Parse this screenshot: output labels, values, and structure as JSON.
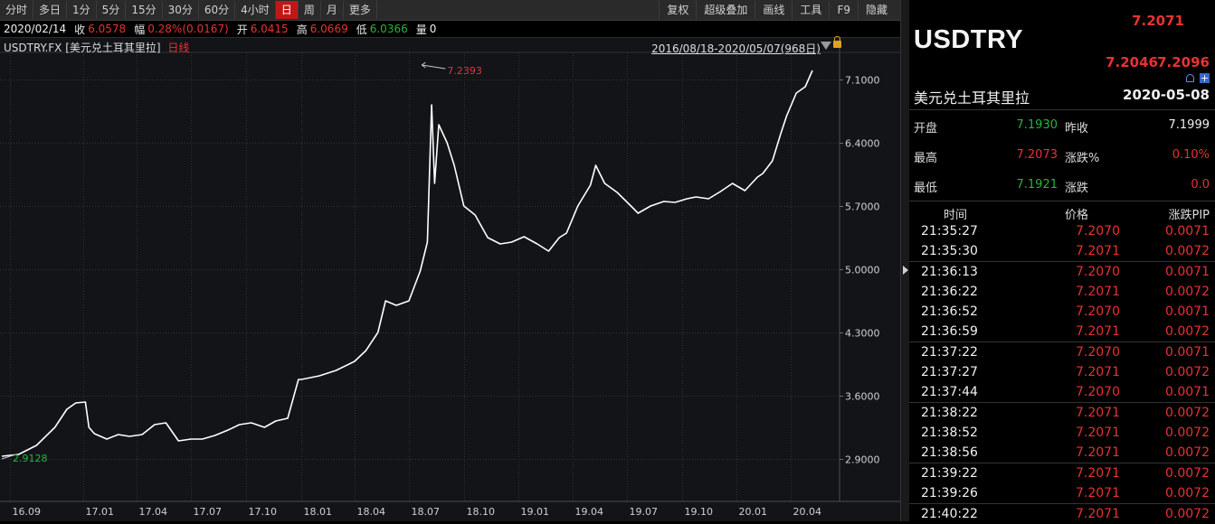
{
  "toolbar": {
    "periods": [
      "分时",
      "多日",
      "1分",
      "5分",
      "15分",
      "30分",
      "60分",
      "4小时",
      "日",
      "周",
      "月",
      "更多"
    ],
    "active_period": "日",
    "right_buttons": [
      "复权",
      "超级叠加",
      "画线",
      "工具",
      "F9",
      "隐藏"
    ]
  },
  "ohlc": {
    "date": "2020/02/14",
    "close_label": "收",
    "close": "6.0578",
    "change_label": "幅",
    "change": "0.28%(0.0167)",
    "open_label": "开",
    "open": "6.0415",
    "high_label": "高",
    "high": "6.0669",
    "low_label": "低",
    "low": "6.0366",
    "volume_label": "量",
    "volume": "0"
  },
  "chart_header": {
    "symbol": "USDTRY.FX",
    "name": "[美元兑土耳其里拉]",
    "period": "日线",
    "range": "2016/08/18-2020/05/07(968日)"
  },
  "chart_data": {
    "type": "line",
    "title": "",
    "x_ticks": [
      "16.09",
      "17.01",
      "17.04",
      "17.07",
      "17.10",
      "18.01",
      "18.04",
      "18.07",
      "18.10",
      "19.01",
      "19.04",
      "19.07",
      "19.10",
      "20.01",
      "20.04"
    ],
    "y_ticks": [
      "7.1000",
      "6.4000",
      "5.7000",
      "5.0000",
      "4.3000",
      "3.6000",
      "2.9000"
    ],
    "ylim": [
      2.6,
      7.3
    ],
    "x": [
      "2016-08-18",
      "2016-09-15",
      "2016-10-15",
      "2016-11-15",
      "2016-12-05",
      "2016-12-20",
      "2017-01-05",
      "2017-01-11",
      "2017-01-20",
      "2017-02-10",
      "2017-03-01",
      "2017-03-20",
      "2017-04-10",
      "2017-05-01",
      "2017-05-20",
      "2017-06-10",
      "2017-07-01",
      "2017-07-20",
      "2017-08-10",
      "2017-09-01",
      "2017-09-20",
      "2017-10-10",
      "2017-11-01",
      "2017-11-20",
      "2017-12-10",
      "2017-12-28",
      "2018-01-02",
      "2018-02-01",
      "2018-03-01",
      "2018-04-01",
      "2018-04-20",
      "2018-05-10",
      "2018-05-23",
      "2018-06-10",
      "2018-07-01",
      "2018-07-20",
      "2018-08-01",
      "2018-08-08",
      "2018-08-13",
      "2018-08-20",
      "2018-08-27",
      "2018-09-03",
      "2018-09-15",
      "2018-10-01",
      "2018-10-20",
      "2018-11-10",
      "2018-12-01",
      "2018-12-20",
      "2019-01-10",
      "2019-02-01",
      "2019-02-20",
      "2019-03-10",
      "2019-03-22",
      "2019-04-10",
      "2019-05-01",
      "2019-05-10",
      "2019-05-25",
      "2019-06-15",
      "2019-07-05",
      "2019-07-20",
      "2019-08-10",
      "2019-09-01",
      "2019-09-20",
      "2019-10-10",
      "2019-10-25",
      "2019-11-15",
      "2019-12-05",
      "2019-12-25",
      "2020-01-15",
      "2020-02-05",
      "2020-02-14",
      "2020-03-01",
      "2020-03-15",
      "2020-03-25",
      "2020-04-10",
      "2020-04-25",
      "2020-05-07"
    ],
    "values": [
      2.93,
      2.95,
      3.05,
      3.25,
      3.45,
      3.52,
      3.53,
      3.25,
      3.18,
      3.12,
      3.17,
      3.15,
      3.17,
      3.28,
      3.3,
      3.1,
      3.12,
      3.12,
      3.16,
      3.22,
      3.28,
      3.3,
      3.25,
      3.32,
      3.35,
      3.78,
      3.78,
      3.82,
      3.88,
      3.98,
      4.1,
      4.3,
      4.65,
      4.6,
      4.65,
      4.98,
      5.3,
      6.82,
      5.95,
      6.6,
      6.5,
      6.4,
      6.15,
      5.7,
      5.6,
      5.35,
      5.28,
      5.3,
      5.36,
      5.28,
      5.2,
      5.35,
      5.4,
      5.7,
      5.93,
      6.15,
      5.95,
      5.85,
      5.72,
      5.62,
      5.7,
      5.75,
      5.74,
      5.78,
      5.8,
      5.78,
      5.86,
      5.95,
      5.87,
      6.02,
      6.06,
      6.2,
      6.5,
      6.7,
      6.95,
      7.02,
      7.2
    ],
    "annotations": [
      {
        "label": "7.2393",
        "x": "2018-08-13",
        "value": 7.2393,
        "color": "#e73232"
      },
      {
        "label": "2.9128",
        "x": "2016-08-18",
        "value": 2.9128,
        "color": "#28b43c"
      }
    ]
  },
  "panel": {
    "symbol": "USDTRY",
    "last_price": "7.2071",
    "bid": "7.2046",
    "ask": "7.2096",
    "name_cn": "美元兑土耳其里拉",
    "date": "2020-05-08",
    "stats": [
      {
        "label1": "开盘",
        "value1": "7.1930",
        "color1": "green",
        "label2": "昨收",
        "value2": "7.1999",
        "color2": "white"
      },
      {
        "label1": "最高",
        "value1": "7.2073",
        "color1": "red",
        "label2": "涨跌%",
        "value2": "0.10%",
        "color2": "red"
      },
      {
        "label1": "最低",
        "value1": "7.1921",
        "color1": "green",
        "label2": "涨跌",
        "value2": "0.0",
        "color2": "red"
      }
    ],
    "trade_headers": {
      "time": "时间",
      "price": "价格",
      "pip": "涨跌PIP"
    },
    "trades": [
      {
        "time": "21:35:27",
        "price": "7.2070",
        "pip": "0.0071"
      },
      {
        "time": "21:35:30",
        "price": "7.2071",
        "pip": "0.0072"
      },
      {
        "time": "21:36:13",
        "price": "7.2070",
        "pip": "0.0071"
      },
      {
        "time": "21:36:22",
        "price": "7.2071",
        "pip": "0.0072"
      },
      {
        "time": "21:36:52",
        "price": "7.2070",
        "pip": "0.0071"
      },
      {
        "time": "21:36:59",
        "price": "7.2071",
        "pip": "0.0072"
      },
      {
        "time": "21:37:22",
        "price": "7.2070",
        "pip": "0.0071"
      },
      {
        "time": "21:37:27",
        "price": "7.2071",
        "pip": "0.0072"
      },
      {
        "time": "21:37:44",
        "price": "7.2070",
        "pip": "0.0071"
      },
      {
        "time": "21:38:22",
        "price": "7.2071",
        "pip": "0.0072"
      },
      {
        "time": "21:38:52",
        "price": "7.2071",
        "pip": "0.0072"
      },
      {
        "time": "21:38:56",
        "price": "7.2071",
        "pip": "0.0072"
      },
      {
        "time": "21:39:22",
        "price": "7.2071",
        "pip": "0.0072"
      },
      {
        "time": "21:39:26",
        "price": "7.2071",
        "pip": "0.0072"
      },
      {
        "time": "21:40:22",
        "price": "7.2071",
        "pip": "0.0072"
      }
    ]
  },
  "colors": {
    "up": "#e73232",
    "down": "#28b43c",
    "line": "#ffffff",
    "grid": "#3a3d44",
    "active": "#c01818"
  }
}
